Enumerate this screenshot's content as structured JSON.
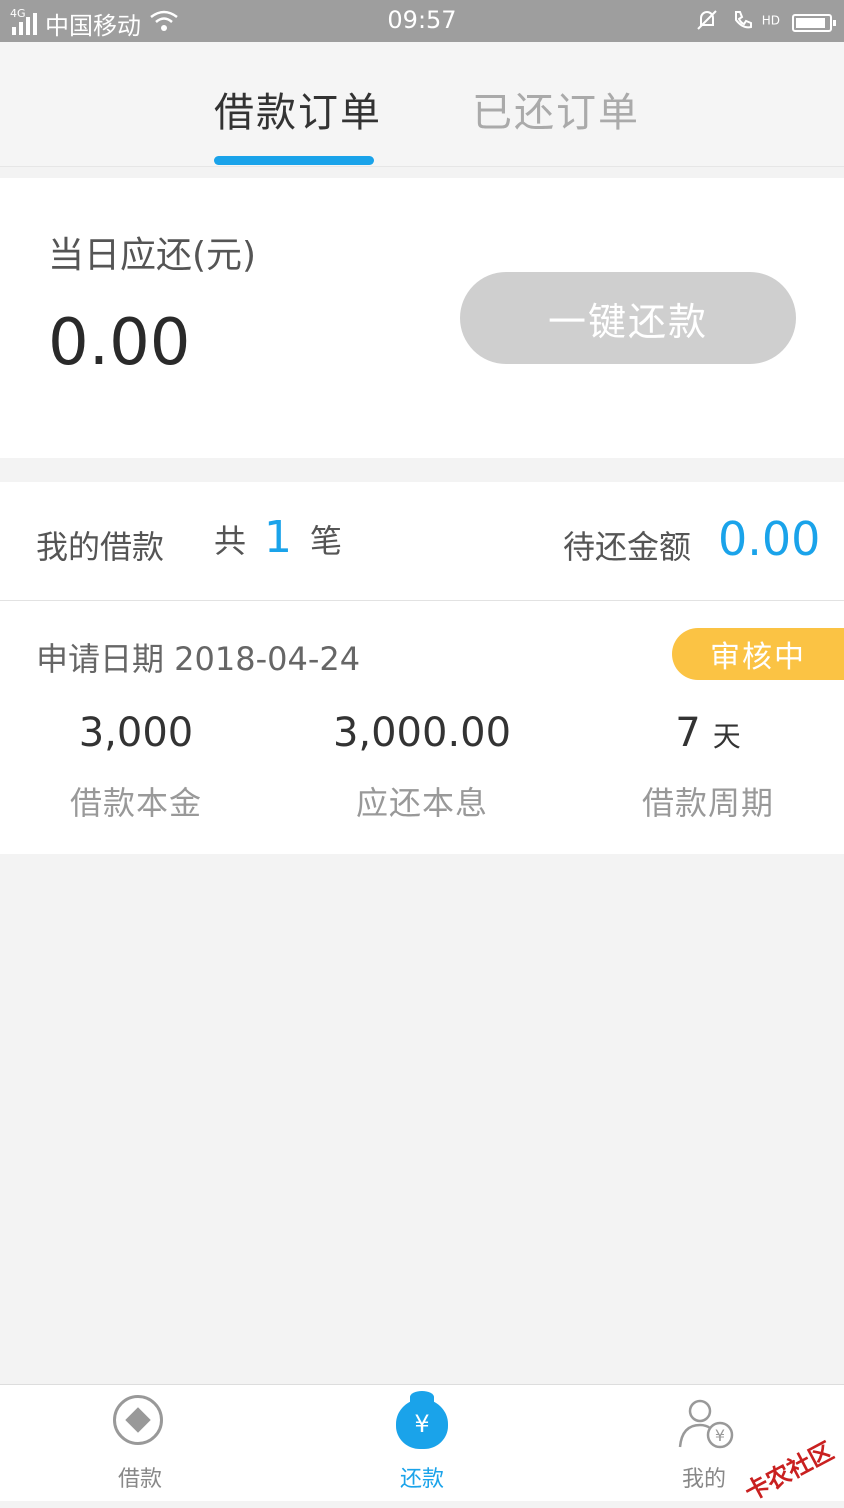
{
  "status_bar": {
    "network": "4G",
    "carrier": "中国移动",
    "time": "09:57",
    "hd_label": "HD",
    "battery_level_percent": 90,
    "icons": [
      "signal-icon",
      "wifi-icon",
      "bell-mute-icon",
      "hd-call-icon",
      "battery-icon"
    ]
  },
  "tabs": {
    "active_label": "借款订单",
    "inactive_label": "已还订单"
  },
  "due": {
    "label": "当日应还(元)",
    "amount": "0.00",
    "pay_button": "一键还款"
  },
  "loans": {
    "title": "我的借款",
    "count_prefix": "共",
    "count": "1",
    "count_suffix": "笔",
    "pending_label": "待还金额",
    "pending_amount": "0.00"
  },
  "order": {
    "apply_date": "申请日期 2018-04-24",
    "status": "审核中",
    "principal_value": "3,000",
    "principal_label": "借款本金",
    "repay_value": "3,000.00",
    "repay_label": "应还本息",
    "period_value": "7",
    "period_unit": "天",
    "period_label": "借款周期"
  },
  "nav": {
    "loan": "借款",
    "repay": "还款",
    "mine": "我的"
  },
  "watermark": "卡农社区",
  "colors": {
    "accent": "#1aa3ea",
    "badge": "#fbc344",
    "disabled_button": "#cfcfcf"
  }
}
